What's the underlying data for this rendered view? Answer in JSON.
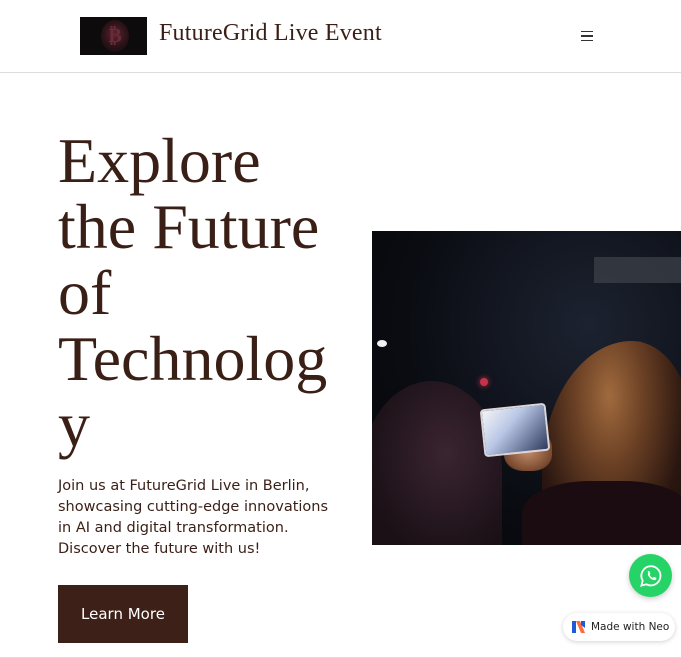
{
  "header": {
    "brand": "FutureGrid Live Event",
    "logo_icon": "bitcoin-logo-icon",
    "menu_icon": "hamburger-menu-icon"
  },
  "hero": {
    "title_lines": [
      "Explore",
      "the Future",
      "of",
      "Technolog",
      "y"
    ],
    "description": "Join us at FutureGrid Live in Berlin, showcasing cutting-edge innovations in AI and digital transformation. Discover the future with us!",
    "cta_label": "Learn More",
    "image_alt": "Crowd at night event holding a tablet"
  },
  "floating": {
    "whatsapp_icon": "whatsapp-icon",
    "badge_label": "Made with Neo",
    "badge_icon": "neo-logo-icon"
  },
  "colors": {
    "text": "#3a1f16",
    "button_bg": "#3d2018",
    "whatsapp": "#25d366"
  }
}
